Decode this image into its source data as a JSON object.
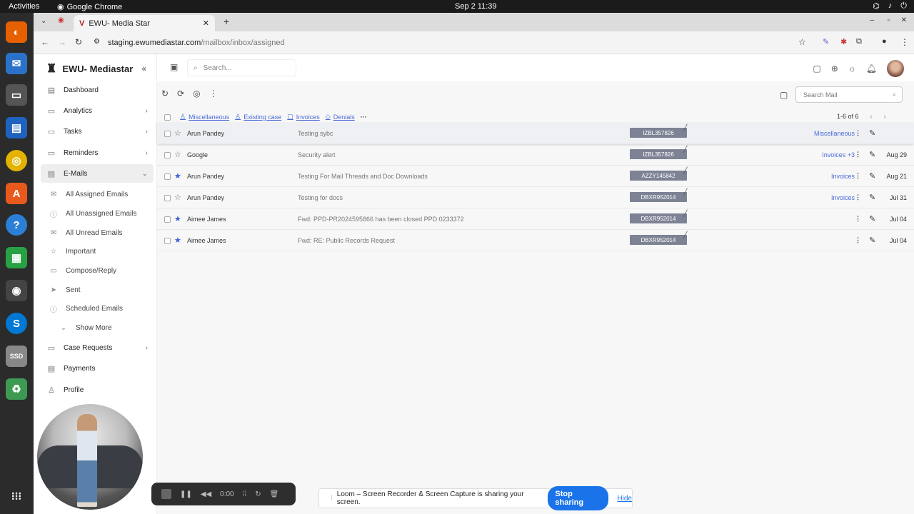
{
  "topbar": {
    "activities": "Activities",
    "app": "Google Chrome",
    "clock": "Sep 2  11:39"
  },
  "browser": {
    "tab_title": "EWU- Media Star",
    "url_domain": "staging.ewumediastar.com",
    "url_path": "/mailbox/inbox/assigned"
  },
  "sidebar": {
    "brand": "EWU- Mediastar",
    "nav": [
      {
        "label": "Dashboard"
      },
      {
        "label": "Analytics"
      },
      {
        "label": "Tasks"
      },
      {
        "label": "Reminders"
      },
      {
        "label": "E-Mails"
      }
    ],
    "email_sub": [
      {
        "label": "All Assigned Emails"
      },
      {
        "label": "All Unassigned Emails"
      },
      {
        "label": "All Unread Emails"
      },
      {
        "label": "Important"
      },
      {
        "label": "Compose/Reply"
      },
      {
        "label": "Sent"
      },
      {
        "label": "Scheduled Emails"
      },
      {
        "label": "Show More"
      }
    ],
    "nav2": [
      {
        "label": "Case Requests"
      },
      {
        "label": "Payments"
      },
      {
        "label": "Profile"
      }
    ]
  },
  "header": {
    "search_placeholder": "Search..."
  },
  "mail": {
    "search_placeholder": "Search Mail",
    "filters": [
      "Miscellaneous",
      "Existing case",
      "Invoices",
      "Denials"
    ],
    "pager": "1-6 of 6",
    "rows": [
      {
        "from": "Arun Pandey",
        "subject": "Testing sybc",
        "case": "IZBL357826",
        "tag": "Miscellaneous",
        "date": "",
        "starred": false
      },
      {
        "from": "Google",
        "subject": "Security alert",
        "case": "IZBL357826",
        "tag": "Invoices +3",
        "date": "Aug 29",
        "starred": false
      },
      {
        "from": "Arun Pandey",
        "subject": "Testing For Mail Threads and Doc Downloads",
        "case": "AZZY145842",
        "tag": "Invoices",
        "date": "Aug 21",
        "starred": true
      },
      {
        "from": "Arun Pandey",
        "subject": "Testing for docs",
        "case": "DBXR952014",
        "tag": "Invoices",
        "date": "Jul 31",
        "starred": false
      },
      {
        "from": "Aimee James",
        "subject": "Fwd: PPD-PR2024595866  has been closed PPD:0233372",
        "case": "DBXR952014",
        "tag": "",
        "date": "Jul 04",
        "starred": true
      },
      {
        "from": "Aimee James",
        "subject": "Fwd: RE: Public Records Request",
        "case": "DBXR952014",
        "tag": "",
        "date": "Jul 04",
        "starred": true
      }
    ]
  },
  "recorder": {
    "time": "0:00"
  },
  "loom": {
    "message": "Loom – Screen Recorder & Screen Capture is sharing your screen.",
    "stop": "Stop sharing",
    "hide": "Hide"
  },
  "colors": {
    "link": "#4a6bd6",
    "star": "#3f5fd1",
    "case_badge": "#7d8294",
    "stop_button": "#1a73e8"
  }
}
